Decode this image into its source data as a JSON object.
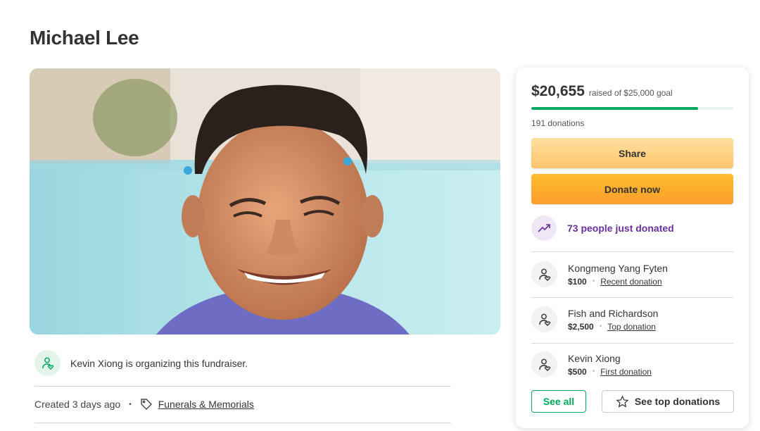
{
  "campaign": {
    "title": "Michael Lee",
    "organizer_text": "Kevin Xiong is organizing this fundraiser.",
    "created": "Created 3 days ago",
    "separator": "•",
    "category": "Funerals & Memorials"
  },
  "donation_card": {
    "raised_amount": "$20,655",
    "goal_text": "raised of $25,000 goal",
    "progress_fraction": 0.826,
    "donation_count": "191 donations",
    "share_label": "Share",
    "donate_label": "Donate now",
    "trend_text": "73 people just donated",
    "donors": [
      {
        "name": "Kongmeng Yang Fyten",
        "amount": "$100",
        "label": "Recent donation"
      },
      {
        "name": "Fish and Richardson",
        "amount": "$2,500",
        "label": "Top donation"
      },
      {
        "name": "Kevin Xiong",
        "amount": "$500",
        "label": "First donation"
      }
    ],
    "see_all_label": "See all",
    "see_top_label": "See top donations"
  },
  "colors": {
    "brand_green": "#02a95c",
    "donate_orange": "#fd9e2c",
    "trend_purple": "#6b2fa0"
  },
  "icons": {
    "organizer": "person-heart-icon",
    "category": "tag-icon",
    "trend": "trending-up-icon",
    "donor": "person-heart-icon",
    "top": "star-icon"
  }
}
